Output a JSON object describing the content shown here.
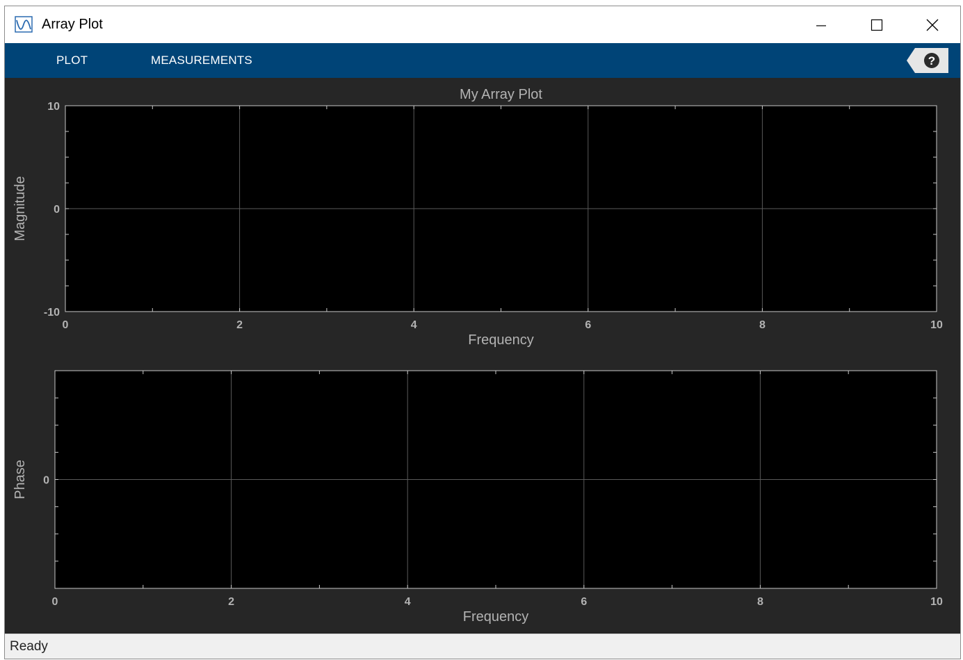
{
  "window": {
    "title": "Array Plot"
  },
  "titlebar": {
    "icon": "array-plot-icon",
    "minimize_icon": "minimize-icon",
    "maximize_icon": "maximize-icon",
    "close_icon": "close-icon"
  },
  "toolstrip": {
    "tabs": [
      {
        "label": "PLOT"
      },
      {
        "label": "MEASUREMENTS"
      }
    ],
    "help_icon": "help-icon",
    "help_label": "?"
  },
  "status": {
    "text": "Ready"
  },
  "colors": {
    "toolstrip": "#004477",
    "background": "#262626",
    "axes": "#000000",
    "grid": "#5a5a5a",
    "text": "#b3b3b3"
  },
  "chart_data": [
    {
      "type": "line",
      "title": "My Array Plot",
      "xlabel": "Frequency",
      "ylabel": "Magnitude",
      "xlim": [
        0,
        10
      ],
      "ylim": [
        -10,
        10
      ],
      "xticks": [
        0,
        2,
        4,
        6,
        8,
        10
      ],
      "yticks": [
        -10,
        0,
        10
      ],
      "grid": true,
      "series": []
    },
    {
      "type": "line",
      "title": "",
      "xlabel": "Frequency",
      "ylabel": "Phase",
      "xlim": [
        0,
        10
      ],
      "ylim": [
        -1,
        1
      ],
      "xticks": [
        0,
        2,
        4,
        6,
        8,
        10
      ],
      "yticks": [
        0
      ],
      "grid": true,
      "series": []
    }
  ]
}
